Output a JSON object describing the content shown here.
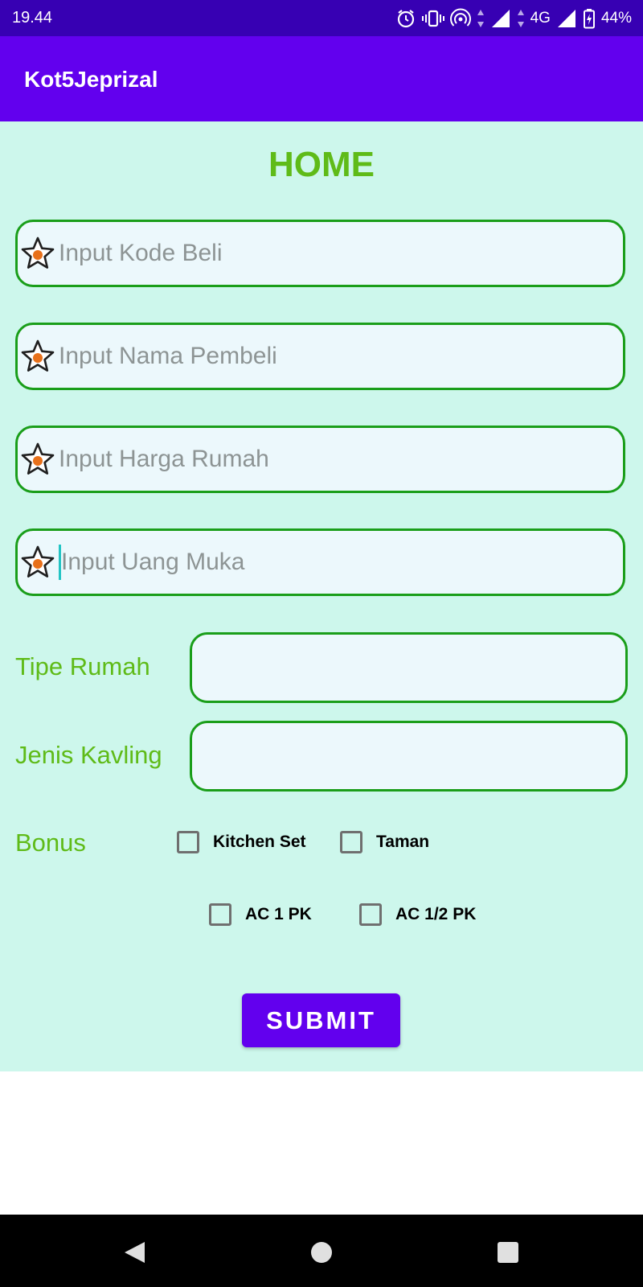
{
  "status_bar": {
    "time": "19.44",
    "network": "4G",
    "battery": "44%",
    "icons": [
      "alarm-icon",
      "vibrate-icon",
      "hotspot-icon",
      "data-arrows-icon",
      "signal-icon",
      "battery-charging-icon"
    ]
  },
  "app_bar": {
    "title": "Kot5Jeprizal"
  },
  "form": {
    "title": "HOME",
    "fields": [
      {
        "placeholder": "Input Kode Beli",
        "icon": "star-icon"
      },
      {
        "placeholder": "Input Nama Pembeli",
        "icon": "star-icon"
      },
      {
        "placeholder": "Input Harga Rumah",
        "icon": "star-icon"
      },
      {
        "placeholder": "Input Uang Muka",
        "icon": "star-icon",
        "focused": true
      }
    ],
    "tipe_rumah": {
      "label": "Tipe Rumah",
      "value": ""
    },
    "jenis_kavling": {
      "label": "Jenis Kavling",
      "value": ""
    },
    "bonus": {
      "label": "Bonus",
      "options": [
        {
          "label": "Kitchen Set",
          "checked": false
        },
        {
          "label": "Taman",
          "checked": false
        },
        {
          "label": "AC 1 PK",
          "checked": false
        },
        {
          "label": "AC 1/2 PK",
          "checked": false
        }
      ]
    },
    "submit_label": "SUBMIT"
  },
  "nav_bar": {
    "icons": [
      "back-icon",
      "home-icon",
      "recents-icon"
    ]
  },
  "colors": {
    "status_bar": "#3700b3",
    "primary": "#6200ee",
    "background": "#cdf7ec",
    "field_fill": "#ecf8fc",
    "field_border": "#1a9e1a",
    "label_green": "#5fbb18",
    "placeholder": "#8d9494",
    "star_dot": "#e8701a"
  }
}
